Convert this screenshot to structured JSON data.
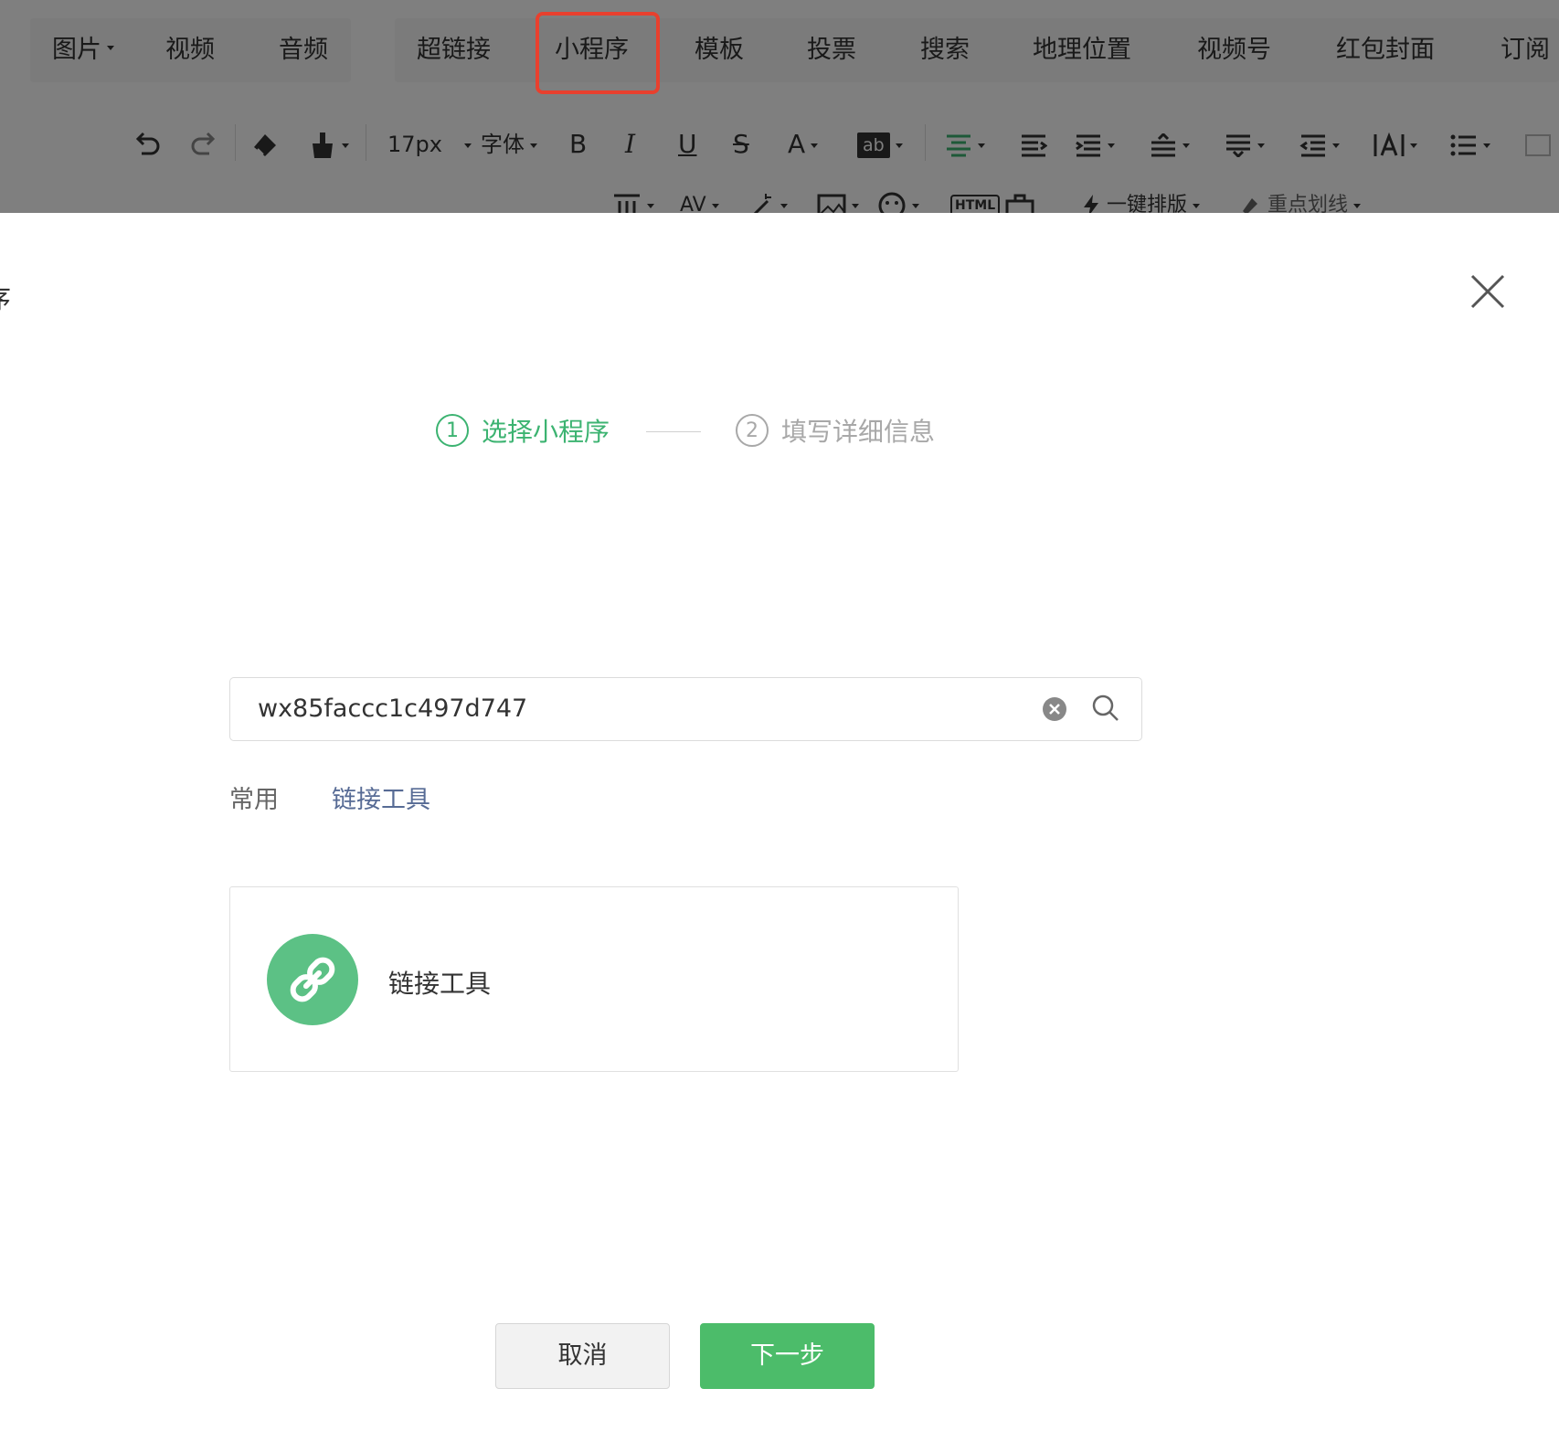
{
  "insert_bar": {
    "items": [
      {
        "label": "图片",
        "has_dropdown": true
      },
      {
        "label": "视频"
      },
      {
        "label": "音频"
      },
      {
        "label": "超链接"
      },
      {
        "label": "小程序",
        "highlighted": true
      },
      {
        "label": "模板"
      },
      {
        "label": "投票"
      },
      {
        "label": "搜索"
      },
      {
        "label": "地理位置"
      },
      {
        "label": "视频号"
      },
      {
        "label": "红包封面"
      },
      {
        "label": "订阅"
      }
    ]
  },
  "format_bar": {
    "font_size": "17px",
    "font_family": "字体",
    "bold": "B",
    "italic": "I",
    "underline": "U",
    "strike": "S",
    "font_color": "A",
    "bg_color": "ab",
    "letter_spacing": "AV",
    "one_click_layout": "一键排版",
    "highlight_line": "重点划线",
    "html_icon": "HTML"
  },
  "dialog": {
    "title_partial": "序",
    "steps": [
      {
        "num": "1",
        "label": "选择小程序",
        "state": "active"
      },
      {
        "num": "2",
        "label": "填写详细信息",
        "state": "todo"
      }
    ],
    "search": {
      "value": "wx85faccc1c497d747"
    },
    "tabs": [
      {
        "label": "常用"
      },
      {
        "label": "链接工具"
      }
    ],
    "result_card": {
      "name": "链接工具",
      "icon": "link-icon"
    },
    "buttons": {
      "cancel": "取消",
      "next": "下一步"
    }
  },
  "colors": {
    "accent_green": "#3cb371",
    "primary_button": "#4cbc6a",
    "link_blue": "#576b95",
    "highlight_red": "#e8402e"
  }
}
